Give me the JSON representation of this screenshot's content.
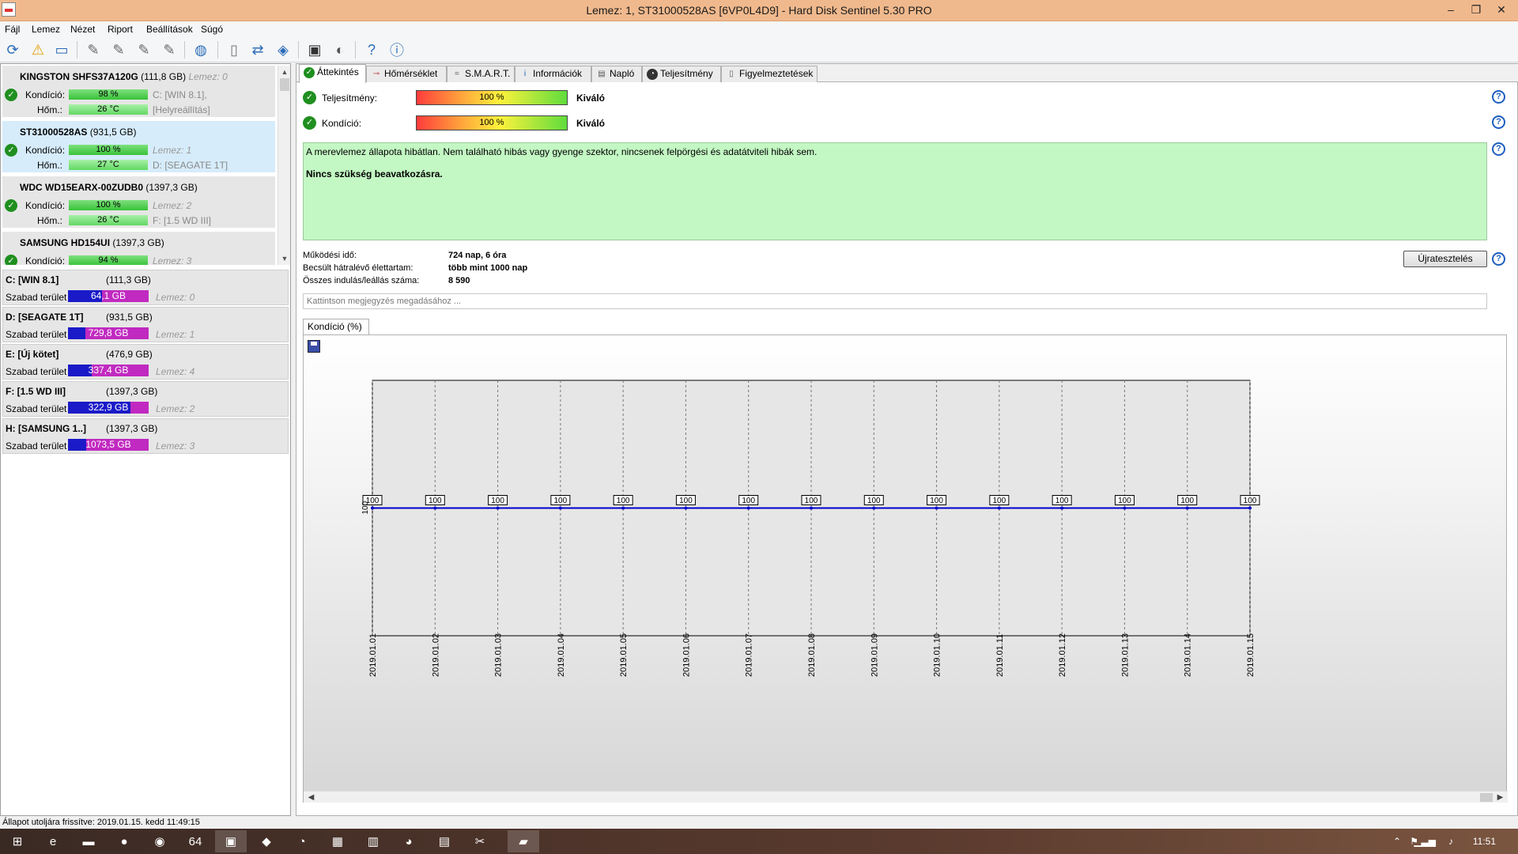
{
  "window": {
    "title": "Lemez: 1, ST31000528AS [6VP0L4D9]  -  Hard Disk Sentinel 5.30 PRO",
    "controls": [
      "–",
      "❐",
      "✕"
    ]
  },
  "menu": [
    "Fájl",
    "Lemez",
    "Nézet",
    "Riport",
    "Beállítások",
    "Súgó"
  ],
  "toolbar": {
    "icons": [
      "refresh-icon",
      "warning-icon",
      "disk-icon",
      "tool-icon",
      "tool-icon",
      "tool-icon",
      "tool-icon",
      "globe-icon",
      "document-icon",
      "sync-icon",
      "network-icon",
      "monitor-icon",
      "speaker-icon",
      "help-icon",
      "info-icon"
    ]
  },
  "disks": [
    {
      "name": "KINGSTON SHFS37A120G",
      "size": "(111,8 GB)",
      "lemez": "Lemez: 0",
      "cond_label": "Kondíció:",
      "cond": "98 %",
      "cond_pct": 98,
      "temp_label": "Hőm.:",
      "temp": "26 °C",
      "info1": "C: [WIN 8.1],",
      "info2": "[Helyreállítás]",
      "selected": false
    },
    {
      "name": "ST31000528AS",
      "size": "(931,5 GB)",
      "lemez": "",
      "cond_label": "Kondíció:",
      "cond": "100 %",
      "cond_pct": 100,
      "temp_label": "Hőm.:",
      "temp": "27 °C",
      "info1": "Lemez: 1",
      "info2": "D: [SEAGATE 1T]",
      "selected": true
    },
    {
      "name": "WDC WD15EARX-00ZUDB0",
      "size": "(1397,3 GB)",
      "lemez": "",
      "cond_label": "Kondíció:",
      "cond": "100 %",
      "cond_pct": 100,
      "temp_label": "Hőm.:",
      "temp": "26 °C",
      "info1": "Lemez: 2",
      "info2": "F: [1.5 WD III]",
      "selected": false
    },
    {
      "name": "SAMSUNG HD154UI",
      "size": "(1397,3 GB)",
      "lemez": "",
      "cond_label": "Kondíció:",
      "cond": "94 %",
      "cond_pct": 94,
      "temp_label": "",
      "temp": "",
      "info1": "Lemez: 3",
      "info2": "",
      "selected": false
    }
  ],
  "volumes": [
    {
      "name": "C: [WIN 8.1]",
      "size": "(111,3 GB)",
      "free_label": "Szabad terület",
      "free": "64,1 GB",
      "used_pct": 42,
      "lemez": "Lemez: 0"
    },
    {
      "name": "D: [SEAGATE 1T]",
      "size": "(931,5 GB)",
      "free_label": "Szabad terület",
      "free": "729,8 GB",
      "used_pct": 22,
      "lemez": "Lemez: 1"
    },
    {
      "name": "E: [Új kötet]",
      "size": "(476,9 GB)",
      "free_label": "Szabad terület",
      "free": "337,4 GB",
      "used_pct": 29,
      "lemez": "Lemez: 4"
    },
    {
      "name": "F: [1.5 WD III]",
      "size": "(1397,3 GB)",
      "free_label": "Szabad terület",
      "free": "322,9 GB",
      "used_pct": 77,
      "lemez": "Lemez: 2"
    },
    {
      "name": "H: [SAMSUNG 1..]",
      "size": "(1397,3 GB)",
      "free_label": "Szabad terület",
      "free": "1073,5 GB",
      "used_pct": 23,
      "lemez": "Lemez: 3"
    }
  ],
  "tabs": [
    {
      "label": "Áttekintés",
      "icon": "check-icon",
      "active": true
    },
    {
      "label": "Hőmérséklet",
      "icon": "thermometer-icon",
      "active": false
    },
    {
      "label": "S.M.A.R.T.",
      "icon": "smart-icon",
      "active": false
    },
    {
      "label": "Információk",
      "icon": "info-icon",
      "active": false
    },
    {
      "label": "Napló",
      "icon": "log-icon",
      "active": false
    },
    {
      "label": "Teljesítmény",
      "icon": "performance-icon",
      "active": false
    },
    {
      "label": "Figyelmeztetések",
      "icon": "alerts-icon",
      "active": false
    }
  ],
  "overview": {
    "performance": {
      "label": "Teljesítmény:",
      "value": "100 %",
      "pct": 100,
      "rating": "Kiváló"
    },
    "condition": {
      "label": "Kondíció:",
      "value": "100 %",
      "pct": 100,
      "rating": "Kiváló"
    },
    "status_text": "A merevlemez állapota hibátlan. Nem található hibás vagy gyenge szektor, nincsenek felpörgési és adatátviteli hibák sem.",
    "status_action": "Nincs szükség beavatkozásra.",
    "stats": [
      {
        "label": "Működési idő:",
        "value": "724 nap, 6 óra"
      },
      {
        "label": "Becsült hátralévő élettartam:",
        "value": "több mint 1000 nap"
      },
      {
        "label": "Összes indulás/leállás száma:",
        "value": "8 590"
      }
    ],
    "retest_label": "Újratesztelés",
    "note_placeholder": "Kattintson megjegyzés megadásához ...",
    "graph_tab": "Kondíció  (%)"
  },
  "chart_data": {
    "type": "line",
    "title": "",
    "xlabel": "",
    "ylabel": "",
    "x": [
      "2019.01.01",
      "2019.01.02",
      "2019.01.03",
      "2019.01.04",
      "2019.01.05",
      "2019.01.06",
      "2019.01.07",
      "2019.01.08",
      "2019.01.09",
      "2019.01.10",
      "2019.01.11",
      "2019.01.12",
      "2019.01.13",
      "2019.01.14",
      "2019.01.15"
    ],
    "series": [
      {
        "values": [
          100,
          100,
          100,
          100,
          100,
          100,
          100,
          100,
          100,
          100,
          100,
          100,
          100,
          100,
          100
        ],
        "color": "#0000cc"
      }
    ],
    "y_tick_labels": [
      "100"
    ],
    "ylim": [
      0,
      200
    ],
    "grid": "vertical dashed",
    "data_labels": true
  },
  "statusbar": "Állapot utoljára frissítve: 2019.01.15. kedd 11:49:15",
  "taskbar": {
    "items": [
      "windows-start-icon",
      "ie-icon",
      "explorer-icon",
      "opera-icon",
      "chrome-icon",
      "app-64-icon",
      "save-app-icon",
      "paint-icon",
      "media-icon",
      "app-icon",
      "calc-icon",
      "app-icon",
      "notes-icon",
      "tool-icon",
      "hd-sentinel-icon"
    ],
    "item_glyphs": [
      "⊞",
      "e",
      "▬",
      "●",
      "◉",
      "64",
      "▣",
      "◆",
      "◔",
      "▦",
      "▥",
      "◕",
      "▤",
      "✂",
      "▰"
    ],
    "clock": "11:51"
  },
  "colors": {
    "ok_green": "#1f8f1f",
    "status_bg": "#c3f7c3",
    "free_bar": "#c02ac0",
    "used_bar": "#1a1ac8",
    "line": "#0000cc"
  }
}
